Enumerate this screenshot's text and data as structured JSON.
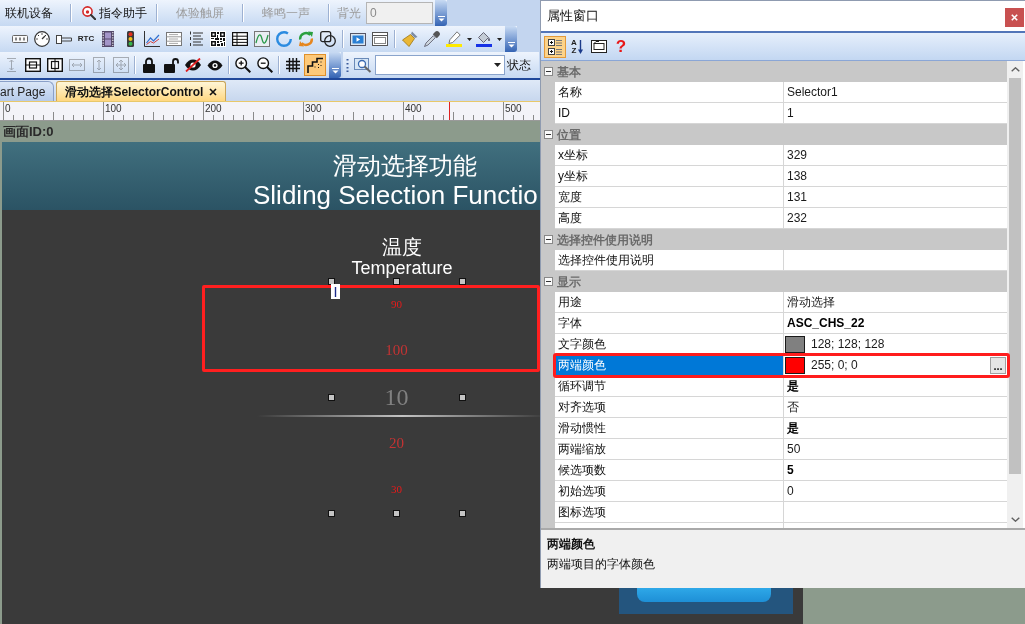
{
  "command_bar": {
    "buttons": [
      {
        "kind": "text",
        "label": "联机设备",
        "disabled": false
      },
      {
        "kind": "icon_text",
        "label": "指令助手",
        "disabled": false
      },
      {
        "kind": "text",
        "label": "体验触屏",
        "disabled": true
      },
      {
        "kind": "text",
        "label": "蜂鸣一声",
        "disabled": true
      }
    ],
    "backlight": {
      "label": "背光",
      "value": "0",
      "disabled": true
    }
  },
  "widget_toolbar": {
    "rtc_label": "RTC"
  },
  "layout_toolbar": {
    "align_buttons": [
      {
        "disabled": true
      },
      {
        "disabled": false
      },
      {
        "disabled": false
      },
      {
        "disabled": true
      },
      {
        "disabled": true
      },
      {
        "disabled": true
      }
    ],
    "grid": {
      "on": false
    },
    "snap": {
      "on": true
    }
  },
  "find_bar": {
    "status_label": "状态"
  },
  "tabs": [
    {
      "label": "art Page",
      "selected": false
    },
    {
      "label": "滑动选择SelectorControl",
      "selected": true
    }
  ],
  "ruler": {
    "labels": [
      "0",
      "100",
      "200",
      "300",
      "400",
      "500"
    ]
  },
  "page_label": "画面ID:0",
  "canvas": {
    "title": "滑动选择功能",
    "subtitle": "Sliding Selection Functio",
    "caption": "温度",
    "caption_en": "Temperature",
    "selector": {
      "options": [
        {
          "text": "90",
          "selected": false,
          "highlighted": true
        },
        {
          "text": "100",
          "selected": false,
          "highlighted": true
        },
        {
          "text": "10",
          "selected": true,
          "highlighted": false
        },
        {
          "text": "20",
          "selected": false,
          "highlighted": false
        },
        {
          "text": "30",
          "selected": false,
          "highlighted": false
        }
      ]
    }
  },
  "property_window": {
    "title": "属性窗口",
    "view_buttons": [
      {
        "kind": "categorized",
        "selected": true
      },
      {
        "kind": "alphabetical",
        "label": "AZ",
        "selected": false
      }
    ],
    "help_glyph": "?",
    "categories": [
      {
        "name": "基本",
        "expanded": true,
        "rows": [
          {
            "kind": "text",
            "name": "名称",
            "value": "Selector1",
            "modified": false,
            "selected": false,
            "highlighted": false
          },
          {
            "kind": "text",
            "name": "ID",
            "value": "1",
            "modified": false,
            "selected": false,
            "highlighted": false
          }
        ]
      },
      {
        "name": "位置",
        "expanded": true,
        "rows": [
          {
            "kind": "text",
            "name": "x坐标",
            "value": "329",
            "modified": false,
            "selected": false,
            "highlighted": false
          },
          {
            "kind": "text",
            "name": "y坐标",
            "value": "138",
            "modified": false,
            "selected": false,
            "highlighted": false
          },
          {
            "kind": "text",
            "name": "宽度",
            "value": "131",
            "modified": false,
            "selected": false,
            "highlighted": false
          },
          {
            "kind": "text",
            "name": "高度",
            "value": "232",
            "modified": false,
            "selected": false,
            "highlighted": false
          }
        ]
      },
      {
        "name": "选择控件使用说明",
        "expanded": true,
        "rows": [
          {
            "kind": "text",
            "name": "选择控件使用说明",
            "selected": false,
            "highlighted": false
          }
        ]
      },
      {
        "name": "显示",
        "expanded": true,
        "rows": [
          {
            "kind": "text",
            "name": "用途",
            "value": "滑动选择",
            "modified": false,
            "selected": false,
            "highlighted": false
          },
          {
            "kind": "text",
            "name": "字体",
            "value": "ASC_CHS_22",
            "modified": true,
            "selected": false,
            "highlighted": false
          },
          {
            "kind": "color",
            "name": "文字颜色",
            "value": "128; 128; 128",
            "color": "#808080",
            "modified": false,
            "selected": false,
            "highlighted": false
          },
          {
            "kind": "color",
            "name": "两端颜色",
            "value": "255; 0; 0",
            "color": "#ff0000",
            "button": "...",
            "modified": false,
            "selected": true,
            "highlighted": true
          },
          {
            "kind": "text",
            "name": "循环调节",
            "value": "是",
            "modified": true,
            "selected": false,
            "highlighted": false
          },
          {
            "kind": "text",
            "name": "对齐选项",
            "value": "否",
            "modified": false,
            "selected": false,
            "highlighted": false
          },
          {
            "kind": "text",
            "name": "滑动惯性",
            "value": "是",
            "modified": true,
            "selected": false,
            "highlighted": false
          },
          {
            "kind": "text",
            "name": "两端缩放",
            "value": "50",
            "modified": false,
            "selected": false,
            "highlighted": false
          },
          {
            "kind": "text",
            "name": "候选项数",
            "value": "5",
            "modified": true,
            "selected": false,
            "highlighted": false
          },
          {
            "kind": "text",
            "name": "初始选项",
            "value": "0",
            "modified": false,
            "selected": false,
            "highlighted": false
          },
          {
            "kind": "text",
            "name": "图标选项",
            "selected": false,
            "highlighted": false
          }
        ]
      }
    ],
    "description": {
      "title": "两端颜色",
      "text": "两端项目的字体颜色"
    }
  }
}
